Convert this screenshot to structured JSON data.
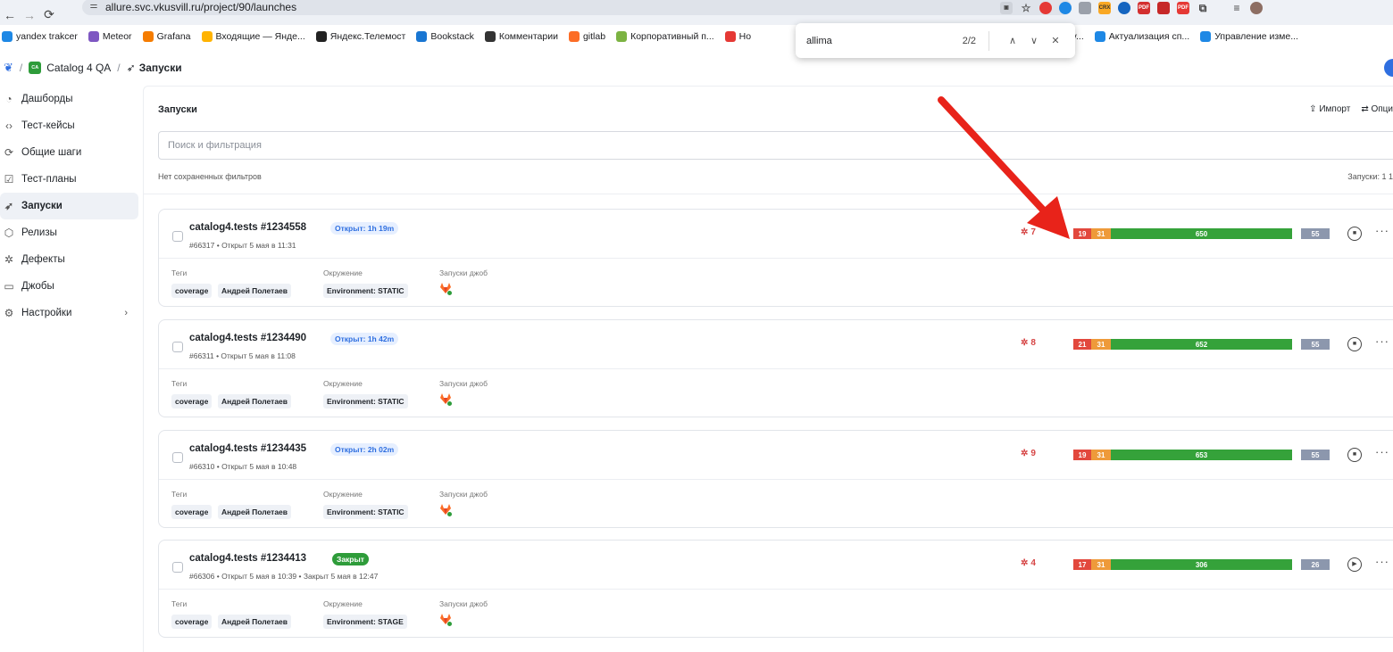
{
  "browser": {
    "url": "allure.svc.vkusvill.ru/project/90/launches"
  },
  "bookmarks": [
    {
      "label": "yandex trakcer",
      "color": "#1e88e5"
    },
    {
      "label": "Meteor",
      "color": "#7e57c2"
    },
    {
      "label": "Grafana",
      "color": "#f57c00"
    },
    {
      "label": "Входящие — Янде...",
      "color": "#ffb300"
    },
    {
      "label": "Яндекс.Телемост",
      "color": "#222222"
    },
    {
      "label": "Bookstack",
      "color": "#1976d2"
    },
    {
      "label": "Комментарии",
      "color": "#333333"
    },
    {
      "label": "gitlab",
      "color": "#fc6d26"
    },
    {
      "label": "Корпоративный п...",
      "color": "#7cb342"
    },
    {
      "label": "Но",
      "color": "#e53935"
    },
    {
      "label": "vc.v...",
      "color": "#1e88e5"
    },
    {
      "label": "Актуализация сп...",
      "color": "#1e88e5"
    },
    {
      "label": "Управление изме...",
      "color": "#1e88e5"
    }
  ],
  "find": {
    "query": "allima",
    "count": "2/2"
  },
  "header": {
    "project": "Catalog 4 QA",
    "project_badge": "CA",
    "current": "Запуски"
  },
  "sidebar": {
    "items": [
      {
        "label": "Дашборды",
        "icon": "pie-chart-icon",
        "glyph": "◔"
      },
      {
        "label": "Тест-кейсы",
        "icon": "code-icon",
        "glyph": "‹›"
      },
      {
        "label": "Общие шаги",
        "icon": "refresh-icon",
        "glyph": "⟳"
      },
      {
        "label": "Тест-планы",
        "icon": "clipboard-icon",
        "glyph": "☑"
      },
      {
        "label": "Запуски",
        "icon": "rocket-icon",
        "glyph": "➶"
      },
      {
        "label": "Релизы",
        "icon": "package-icon",
        "glyph": "⬡"
      },
      {
        "label": "Дефекты",
        "icon": "bug-icon",
        "glyph": "✲"
      },
      {
        "label": "Джобы",
        "icon": "terminal-icon",
        "glyph": "▭"
      },
      {
        "label": "Настройки",
        "icon": "gear-icon",
        "glyph": "⚙"
      }
    ]
  },
  "main": {
    "title": "Запуски",
    "import_label": "Импорт",
    "options_label": "Опци",
    "search_placeholder": "Поиск и фильтрация",
    "no_filters": "Нет сохраненных фильтров",
    "launch_count": "Запуски: 1 1",
    "tags_label": "Теги",
    "env_label": "Окружение",
    "jobs_label": "Запуски джоб"
  },
  "launches": [
    {
      "name": "catalog4.tests #1234558",
      "status": "Открыт: 1h 19m",
      "status_type": "open",
      "meta": "#66317 • Открыт 5 мая в 11:31",
      "tags": [
        "coverage",
        "Андрей Полетаев"
      ],
      "env": "Environment: STATIC",
      "defects": "7",
      "failed": 19,
      "broken": 31,
      "passed": 650,
      "skipped": 55,
      "action": "stop"
    },
    {
      "name": "catalog4.tests #1234490",
      "status": "Открыт: 1h 42m",
      "status_type": "open",
      "meta": "#66311 • Открыт 5 мая в 11:08",
      "tags": [
        "coverage",
        "Андрей Полетаев"
      ],
      "env": "Environment: STATIC",
      "defects": "8",
      "failed": 21,
      "broken": 31,
      "passed": 652,
      "skipped": 55,
      "action": "stop"
    },
    {
      "name": "catalog4.tests #1234435",
      "status": "Открыт: 2h 02m",
      "status_type": "open",
      "meta": "#66310 • Открыт 5 мая в 10:48",
      "tags": [
        "coverage",
        "Андрей Полетаев"
      ],
      "env": "Environment: STATIC",
      "defects": "9",
      "failed": 19,
      "broken": 31,
      "passed": 653,
      "skipped": 55,
      "action": "stop"
    },
    {
      "name": "catalog4.tests #1234413",
      "status": "Закрыт",
      "status_type": "closed",
      "meta": "#66306 • Открыт 5 мая в 10:39 • Закрыт 5 мая в 12:47",
      "tags": [
        "coverage",
        "Андрей Полетаев"
      ],
      "env": "Environment: STAGE",
      "defects": "4",
      "failed": 17,
      "broken": 31,
      "passed": 306,
      "skipped": 26,
      "action": "play"
    }
  ],
  "colors": {
    "failed": "#e2483d",
    "broken": "#ee9a3a",
    "passed": "#35a23a",
    "skipped": "#8c97ad",
    "arrow": "#e8231a"
  }
}
